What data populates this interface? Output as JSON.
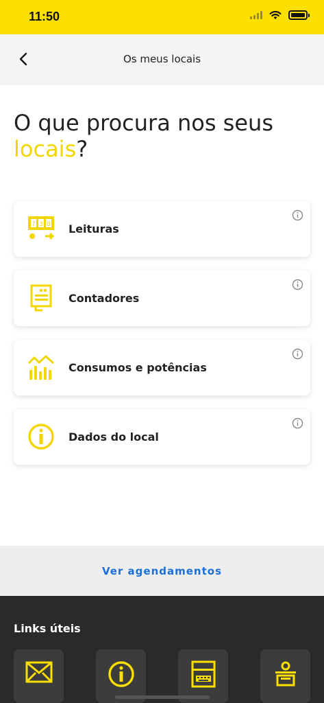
{
  "status_bar": {
    "time": "11:50"
  },
  "nav": {
    "title": "Os meus locais",
    "back_icon": "chevron-left-icon"
  },
  "headline": {
    "text_prefix": "O que procura nos seus ",
    "text_accent": "locais",
    "text_suffix": "?"
  },
  "cards": [
    {
      "label": "Leituras",
      "icon": "meter-reading-icon"
    },
    {
      "label": "Contadores",
      "icon": "meter-device-icon"
    },
    {
      "label": "Consumos e potências",
      "icon": "consumption-chart-icon"
    },
    {
      "label": "Dados do local",
      "icon": "info-circle-icon"
    }
  ],
  "schedules": {
    "link_label": "Ver agendamentos"
  },
  "useful_links": {
    "title": "Links úteis",
    "tiles": [
      {
        "icon": "envelope-icon"
      },
      {
        "icon": "info-circle-icon"
      },
      {
        "icon": "keyboard-terminal-icon"
      },
      {
        "icon": "service-desk-icon"
      }
    ]
  },
  "colors": {
    "brand_yellow": "#fddf00",
    "accent_text": "#f2d600",
    "link_blue": "#1c6fd6",
    "dark_footer": "#2a2a2a"
  }
}
